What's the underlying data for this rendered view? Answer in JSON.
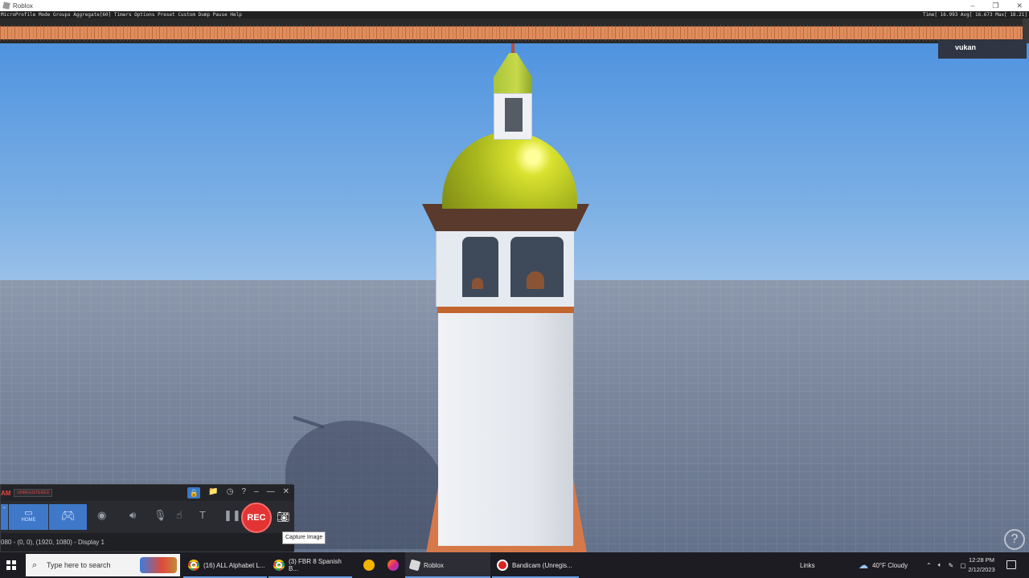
{
  "window": {
    "title": "Roblox",
    "controls": [
      "–",
      "❐",
      "✕"
    ]
  },
  "microprofile": {
    "menu": "MicroProfile  Mode Groups Aggregate[60] Timers Options Preset Custom Dump Pause Help",
    "stats": "Time[ 16.993 Avg[ 16.673 Max[ 18.21]"
  },
  "game": {
    "player_name": "vukan",
    "help_glyph": "?"
  },
  "bandicam": {
    "brand": "AM",
    "unregistered": "UNREGISTERED",
    "tab_home": "HOME",
    "rec_label": "REC",
    "status": "080 - (0, 0), (1920, 1080) - Display 1",
    "tooltip": "Capture Image",
    "top_icons": [
      "🔒",
      "📁",
      "◷",
      "?",
      "–",
      "—",
      "✕"
    ]
  },
  "taskbar": {
    "search_placeholder": "Type here to search",
    "items": [
      {
        "label": "(16) ALL Alphabet L..."
      },
      {
        "label": "(3) FBR 8 Spanish B..."
      },
      {
        "label": "Roblox"
      },
      {
        "label": "Bandicam (Unregis..."
      }
    ],
    "links_label": "Links",
    "weather": "40°F  Cloudy",
    "time": "12:28 PM",
    "date": "2/12/2023"
  }
}
